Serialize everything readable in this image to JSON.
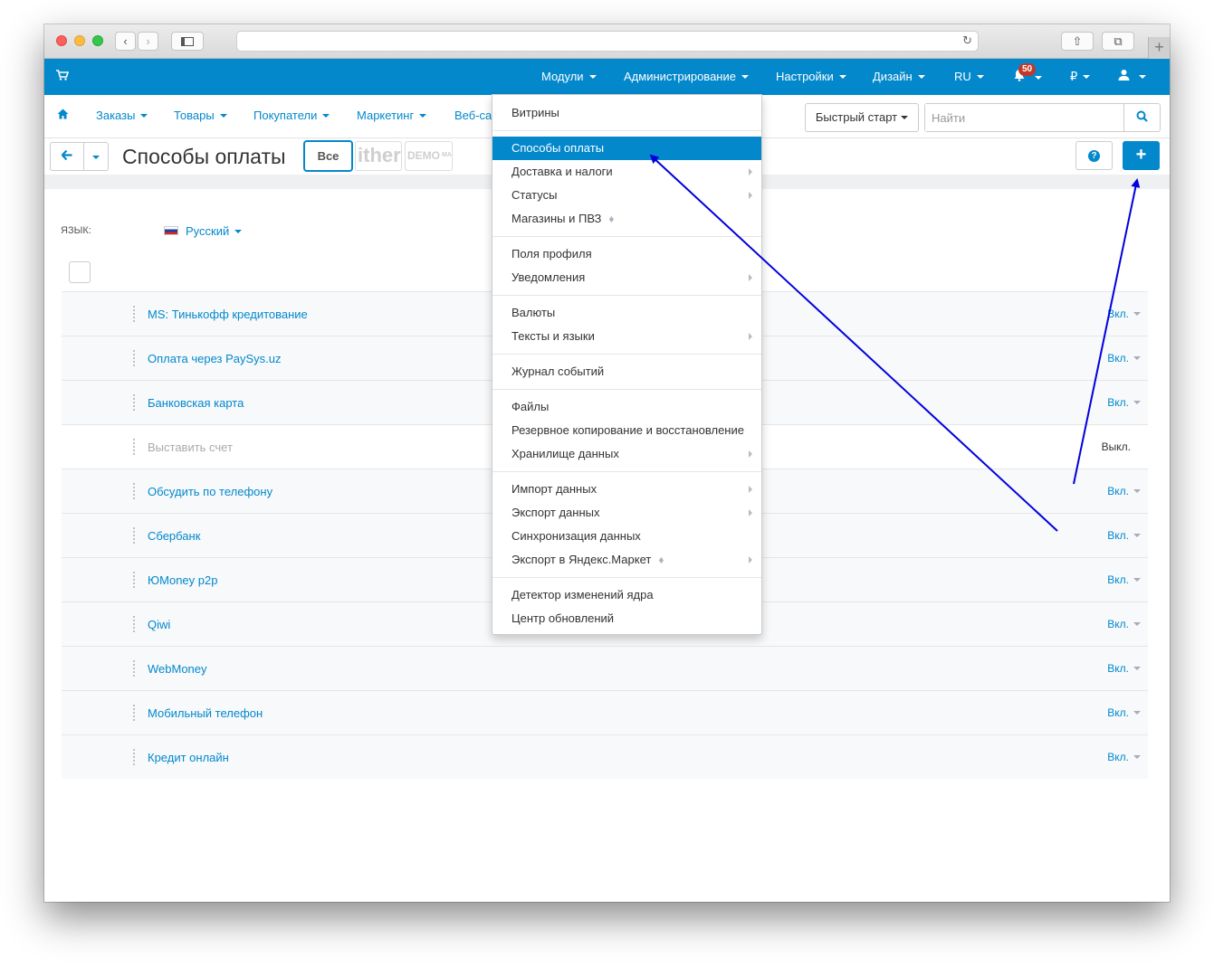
{
  "topnav": {
    "modules": "Модули",
    "administration": "Администрирование",
    "settings": "Настройки",
    "design": "Дизайн",
    "language": "RU",
    "notifications_count": "50",
    "currency": "₽"
  },
  "subnav": {
    "orders": "Заказы",
    "products": "Товары",
    "customers": "Покупатели",
    "marketing": "Маркетинг",
    "website": "Веб-са",
    "quick_start": "Быстрый старт",
    "search_placeholder": "Найти"
  },
  "titlebar": {
    "title": "Способы оплаты",
    "store_all": "Все",
    "store_logo1": "ither",
    "store_logo2": "DEMO",
    "store_logo2_sup": "MA"
  },
  "filter": {
    "language_label": "ЯЗЫК:",
    "language_value": "Русский"
  },
  "payments": [
    {
      "name": "MS: Тинькофф кредитование",
      "status": "Вкл.",
      "enabled": true
    },
    {
      "name": "Оплата через PaySys.uz",
      "status": "Вкл.",
      "enabled": true
    },
    {
      "name": "Банковская карта",
      "status": "Вкл.",
      "enabled": true
    },
    {
      "name": "Выставить счет",
      "status": "Выкл.",
      "enabled": false
    },
    {
      "name": "Обсудить по телефону",
      "status": "Вкл.",
      "enabled": true
    },
    {
      "name": "Сбербанк",
      "status": "Вкл.",
      "enabled": true
    },
    {
      "name": "ЮMoney p2p",
      "status": "Вкл.",
      "enabled": true
    },
    {
      "name": "Qiwi",
      "status": "Вкл.",
      "enabled": true
    },
    {
      "name": "WebMoney",
      "status": "Вкл.",
      "enabled": true
    },
    {
      "name": "Мобильный телефон",
      "status": "Вкл.",
      "enabled": true
    },
    {
      "name": "Кредит онлайн",
      "status": "Вкл.",
      "enabled": true
    }
  ],
  "admin_menu": {
    "storefronts": "Витрины",
    "payment_methods": "Способы оплаты",
    "shipping_taxes": "Доставка и налоги",
    "statuses": "Статусы",
    "stores_pickup": "Магазины и ПВЗ",
    "profile_fields": "Поля профиля",
    "notifications": "Уведомления",
    "currencies": "Валюты",
    "texts_languages": "Тексты и языки",
    "event_log": "Журнал событий",
    "files": "Файлы",
    "backup_restore": "Резервное копирование и восстановление",
    "data_storage": "Хранилище данных",
    "import_data": "Импорт данных",
    "export_data": "Экспорт данных",
    "sync_data": "Синхронизация данных",
    "yandex_export": "Экспорт в Яндекс.Маркет",
    "core_detector": "Детектор изменений ядра",
    "update_center": "Центр обновлений"
  },
  "colors": {
    "primary": "#0388cc",
    "annotation_arrow": "#0000dd"
  }
}
